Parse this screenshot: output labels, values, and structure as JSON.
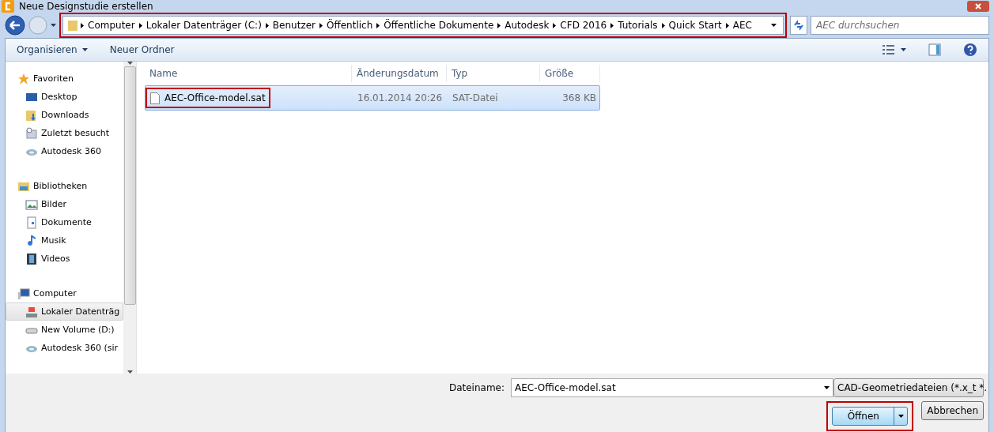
{
  "window": {
    "title": "Neue Designstudie erstellen"
  },
  "breadcrumb": {
    "highlighted": true,
    "segments": [
      "Computer",
      "Lokaler Datenträger (C:)",
      "Benutzer",
      "Öffentlich",
      "Öffentliche Dokumente",
      "Autodesk",
      "CFD 2016",
      "Tutorials",
      "Quick Start",
      "AEC"
    ]
  },
  "search": {
    "placeholder": "AEC durchsuchen"
  },
  "toolbar": {
    "buttons": [
      {
        "label": "Organisieren",
        "dropdown": true
      },
      {
        "label": "Neuer Ordner",
        "dropdown": false
      }
    ]
  },
  "sidebar": {
    "groups": [
      {
        "label": "Favoriten",
        "children": [
          {
            "label": "Desktop",
            "selected": false
          },
          {
            "label": "Downloads",
            "selected": false
          },
          {
            "label": "Zuletzt besucht",
            "selected": false
          },
          {
            "label": "Autodesk 360",
            "selected": false
          }
        ]
      },
      {
        "label": "Bibliotheken",
        "children": [
          {
            "label": "Bilder",
            "selected": false
          },
          {
            "label": "Dokumente",
            "selected": false
          },
          {
            "label": "Musik",
            "selected": false
          },
          {
            "label": "Videos",
            "selected": false
          }
        ]
      },
      {
        "label": "Computer",
        "children": [
          {
            "label": "Lokaler Datenträg",
            "selected": true
          },
          {
            "label": "New Volume (D:)",
            "selected": false
          },
          {
            "label": "Autodesk 360 (sir",
            "selected": false
          }
        ]
      }
    ]
  },
  "table": {
    "columns": [
      "Name",
      "Änderungsdatum",
      "Typ",
      "Größe"
    ],
    "rows": [
      {
        "cells": [
          "AEC-Office-model.sat",
          "16.01.2014 20:26",
          "SAT-Datei",
          "368 KB"
        ],
        "selected": true,
        "highlighted": true
      }
    ]
  },
  "footer": {
    "filename_label": "Dateiname:",
    "filename_value": "AEC-Office-model.sat",
    "filter": "CAD-Geometriedateien (*.x_t *.",
    "open_button": {
      "label": "Öffnen",
      "highlighted": true
    },
    "cancel_button": "Abbrechen"
  }
}
